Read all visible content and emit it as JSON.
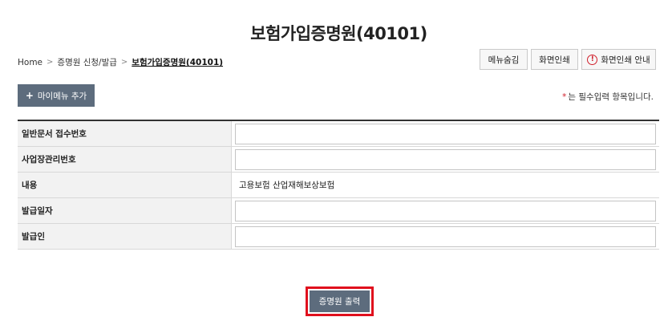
{
  "page": {
    "title": "보험가입증명원(40101)"
  },
  "breadcrumb": {
    "home": "Home",
    "level1": "증명원 신청/발급",
    "current": "보험가입증명원(40101)"
  },
  "toolbar": {
    "hide_menu": "메뉴숨김",
    "print_screen": "화면인쇄",
    "print_guide": "화면인쇄 안내"
  },
  "mymenu": {
    "label": "마이메뉴 추가"
  },
  "notice": {
    "star": "*",
    "text": "는 필수입력 항목입니다."
  },
  "form": {
    "rows": [
      {
        "label": "일반문서 접수번호",
        "value": ""
      },
      {
        "label": "사업장관리번호",
        "value": ""
      },
      {
        "label": "내용",
        "value": "고용보험 산업재해보상보험"
      },
      {
        "label": "발급일자",
        "value": ""
      },
      {
        "label": "발급인",
        "value": ""
      }
    ]
  },
  "actions": {
    "print_certificate": "증명원 출력"
  },
  "colors": {
    "button_bg": "#5d6c7d",
    "highlight_border": "#e0101d",
    "required_star": "#d0202c"
  }
}
